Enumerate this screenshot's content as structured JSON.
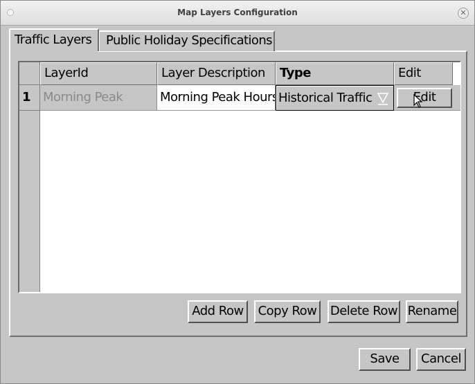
{
  "window": {
    "title": "Map Layers Configuration"
  },
  "tabs": [
    {
      "label": "Traffic Layers",
      "active": true
    },
    {
      "label": "Public Holiday Specifications",
      "active": false
    }
  ],
  "table": {
    "columns": [
      "LayerId",
      "Layer Description",
      "Type",
      "Edit"
    ],
    "rows": [
      {
        "row_number": "1",
        "layer_id": "Morning Peak",
        "layer_description": "Morning Peak Hours",
        "type": "Historical Traffic",
        "edit_label": "Edit"
      }
    ]
  },
  "table_actions": {
    "add_row": "Add Row",
    "copy_row": "Copy Row",
    "delete_row": "Delete Row",
    "rename": "Rename"
  },
  "dialog_actions": {
    "save": "Save",
    "cancel": "Cancel"
  }
}
